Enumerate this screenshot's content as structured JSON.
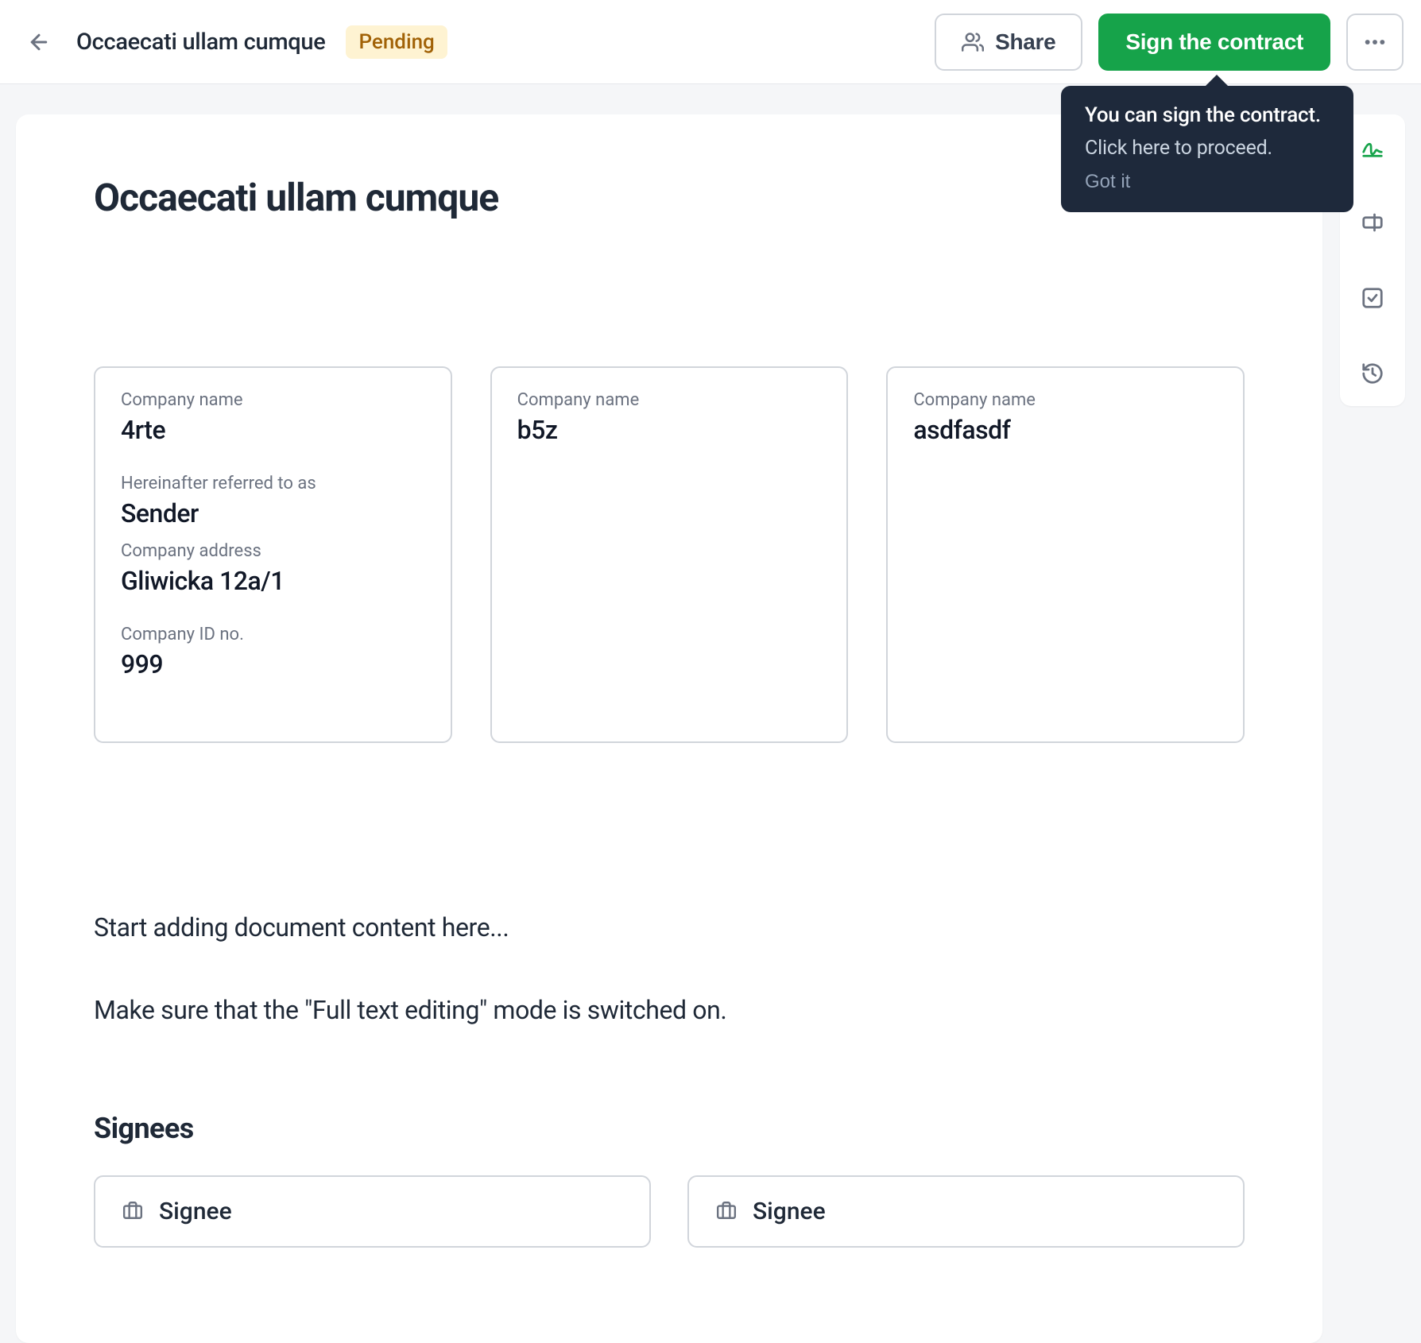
{
  "header": {
    "title": "Occaecati ullam cumque",
    "status": "Pending",
    "share_label": "Share",
    "sign_label": "Sign the contract"
  },
  "tooltip": {
    "line1": "You can sign the contract.",
    "line2": "Click here to proceed.",
    "gotit_label": "Got it"
  },
  "page_title": "Occaecati ullam cumque",
  "companies": [
    {
      "name_label": "Company name",
      "name": "4rte",
      "hereinafter_label": "Hereinafter referred to as",
      "hereinafter": "Sender",
      "address_label": "Company address",
      "address": "Gliwicka 12a/1",
      "id_label": "Company ID no.",
      "id": "999"
    },
    {
      "name_label": "Company name",
      "name": "b5z"
    },
    {
      "name_label": "Company name",
      "name": "asdfasdf"
    }
  ],
  "body": {
    "p1": "Start adding document content here...",
    "p2": "Make sure that the \"Full text editing\" mode is switched on."
  },
  "signees": {
    "heading": "Signees",
    "items": [
      {
        "label": "Signee"
      },
      {
        "label": "Signee"
      }
    ]
  }
}
